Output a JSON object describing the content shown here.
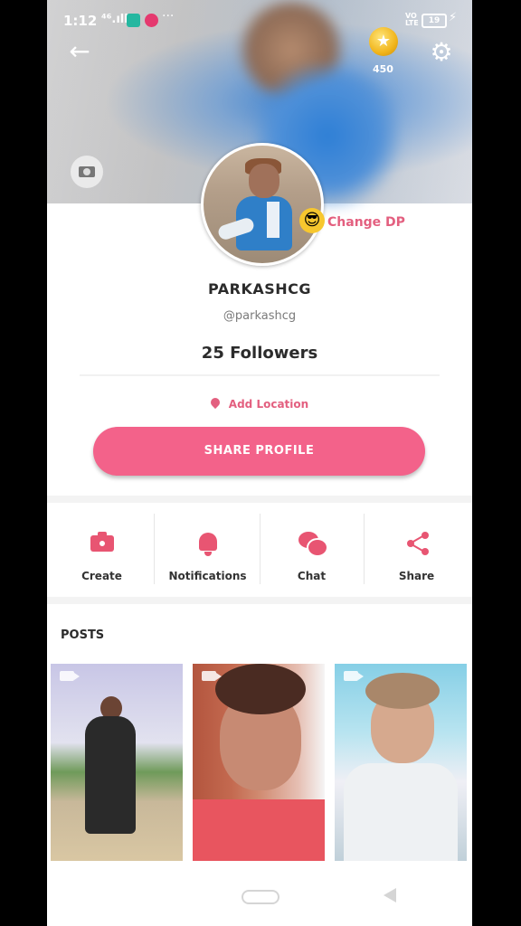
{
  "status_bar": {
    "time": "1:12",
    "signal": "⁴⁶.ıll",
    "more": "···",
    "volte": "VO\nLTE",
    "battery": "19"
  },
  "header": {
    "back_icon": "←",
    "coin_count": "450",
    "settings_icon": "⚙"
  },
  "profile": {
    "change_dp_emoji": "😎",
    "change_dp_label": "Change DP",
    "display_name": "PARKASHCG",
    "username": "@parkashcg",
    "followers": "25 Followers",
    "location_label": "Add Location",
    "share_button_label": "SHARE PROFILE"
  },
  "actions": [
    {
      "label": "Create",
      "icon": "camera-icon"
    },
    {
      "label": "Notifications",
      "icon": "bell-icon"
    },
    {
      "label": "Chat",
      "icon": "chat-icon"
    },
    {
      "label": "Share",
      "icon": "share-icon"
    }
  ],
  "posts": {
    "title": "POSTS",
    "items": [
      "post-1",
      "post-2",
      "post-3"
    ]
  },
  "colors": {
    "accent": "#f3628a",
    "icon": "#e85572",
    "text": "#2b2b2b"
  }
}
